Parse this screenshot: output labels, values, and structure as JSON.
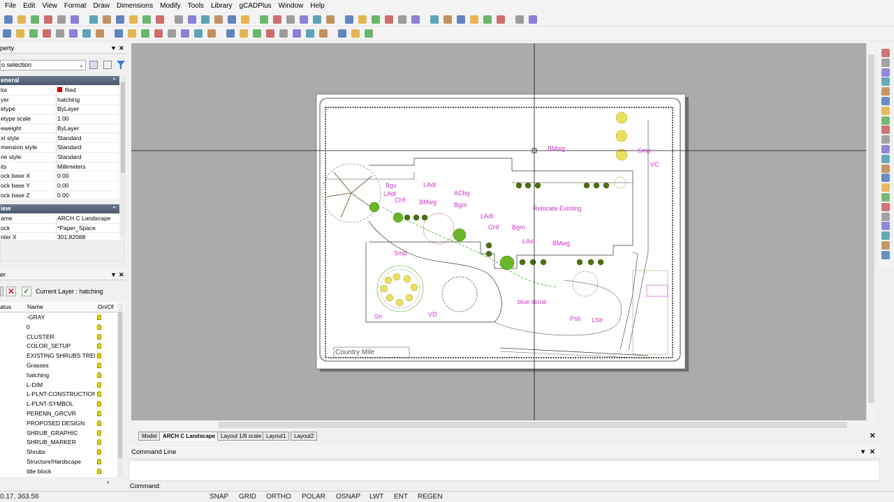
{
  "menu": [
    "File",
    "Edit",
    "View",
    "Format",
    "Draw",
    "Dimensions",
    "Modify",
    "Tools",
    "Library",
    "gCADPlus",
    "Window",
    "Help"
  ],
  "properties": {
    "title": "perty",
    "selection": "o selection",
    "general_header": "eneral",
    "general": [
      {
        "k": "lor",
        "v": "Red"
      },
      {
        "k": "yer",
        "v": "hatching"
      },
      {
        "k": "etype",
        "v": "ByLayer"
      },
      {
        "k": "etype scale",
        "v": "1.00"
      },
      {
        "k": "eweight",
        "v": "ByLayer"
      },
      {
        "k": "xt style",
        "v": "Standard"
      },
      {
        "k": "mension style",
        "v": "Standard"
      },
      {
        "k": "ne style",
        "v": "Standard"
      },
      {
        "k": "its",
        "v": "Millimeters"
      },
      {
        "k": "ock base X",
        "v": "0.00"
      },
      {
        "k": "ock base Y",
        "v": "0.00"
      },
      {
        "k": "ock base Z",
        "v": "0.00"
      }
    ],
    "view_header": "iew",
    "view": [
      {
        "k": "ame",
        "v": "ARCH C Landscape"
      },
      {
        "k": "ock",
        "v": "*Paper_Space"
      },
      {
        "k": "nter X",
        "v": "301.82088"
      }
    ],
    "color_swatch": "#c00000"
  },
  "layers": {
    "title": "er",
    "current": "Current Layer : hatching",
    "col_status": "atus",
    "col_name": "Name",
    "col_onoff": "On/Of",
    "rows": [
      "-GRAY",
      "0",
      "CLUSTER",
      "COLOR_SETUP",
      "EXISTING SHRUBS TREE",
      "Grasses",
      "hatching",
      "L-DIM",
      "L-PLNT-CONSTRUCTION",
      "L-PLNT-SYMBOL",
      "PERENN_GRCVR",
      "PROPOSED DESIGN",
      "SHRUB_GRAPHIC",
      "SHRUB_MARKER",
      "Shrubs",
      "Structure/Hardscape",
      "title block"
    ]
  },
  "drawing": {
    "labels": [
      "BMwg",
      "Smp",
      "VC",
      "Bgv",
      "LAdl",
      "LAdl",
      "CHf",
      "BMwg",
      "ACbg",
      "Bgm",
      "LAdl",
      "CHf",
      "Bgm",
      "Relocate Existing",
      "LAdl",
      "BMwg",
      "Smp",
      "blue stone",
      "Sn",
      "VD",
      "Psb",
      "LStr"
    ],
    "title_block": "Country Mile",
    "magenta": "#cc33cc"
  },
  "tabs": [
    "Model",
    "ARCH C Landscape",
    "Layout 1/8 scale",
    "Layout1",
    "Layout2"
  ],
  "active_tab": "ARCH C Landscape",
  "command": {
    "title": "Command Line",
    "prompt": "Command:"
  },
  "status": {
    "coords": "0.17, 363.56",
    "toggles": [
      "SNAP",
      "GRID",
      "ORTHO",
      "POLAR",
      "OSNAP",
      "LWT",
      "ENT",
      "REGEN"
    ]
  }
}
